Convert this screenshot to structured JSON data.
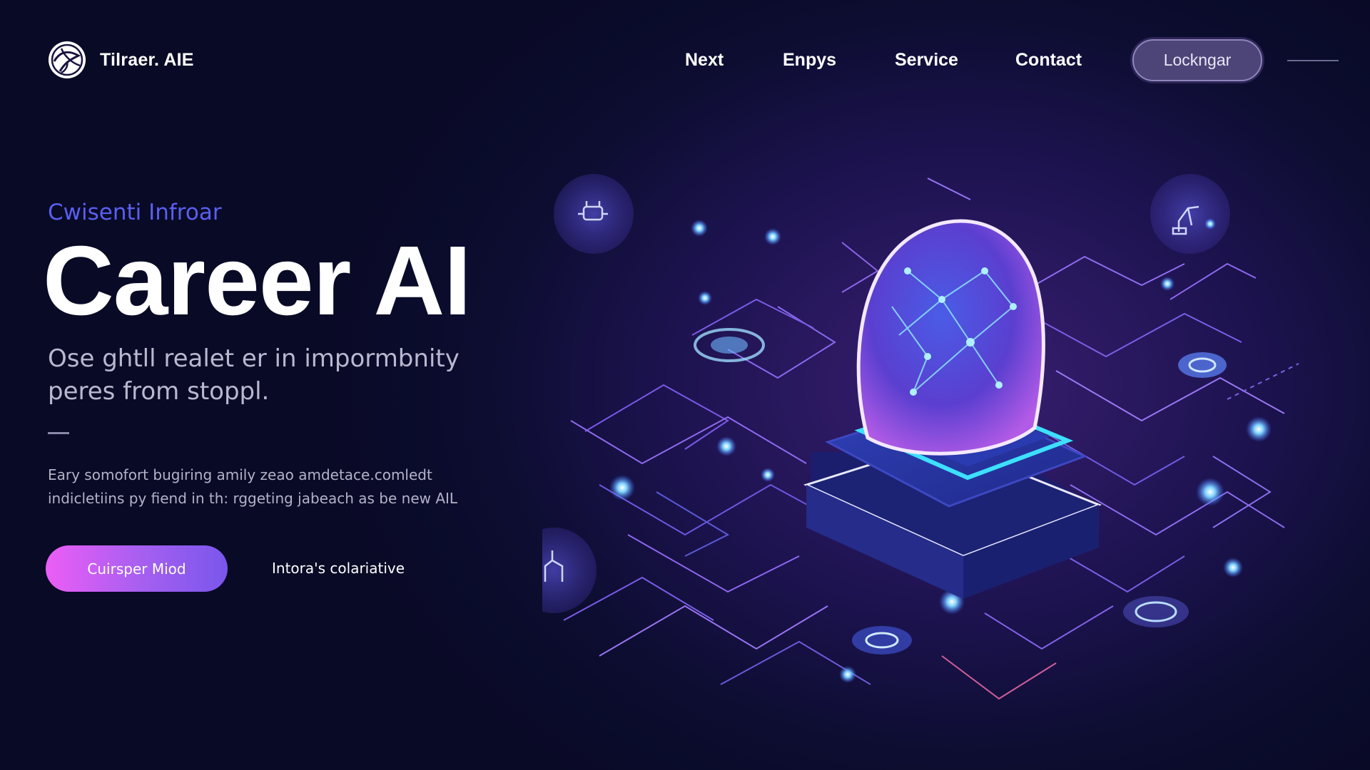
{
  "brand": {
    "name": "Tilraer. AIE",
    "logo_icon": "globe-leaf-logo-icon"
  },
  "nav": {
    "items": [
      "Next",
      "Enpys",
      "Service",
      "Contact"
    ]
  },
  "header": {
    "login_label": "Lockngar",
    "menu_icon": "menu-line-icon"
  },
  "hero": {
    "eyebrow": "Cwisenti Infroar",
    "title": "Career AI",
    "subtitle": "Ose ghtll realet er in impormbnity peres from stoppl.",
    "description": "Eary somofort bugiring amily zeao amdetace.comledt indicletiins py fiend in th: rggeting jabeach as be new AIL",
    "primary_cta": "Cuirsper Miod",
    "secondary_cta": "Intora's colariative"
  },
  "colors": {
    "accent": "#5a5ff0",
    "cta_start": "#ec5ef6",
    "cta_end": "#7a56ec",
    "background": "#0c0d30"
  },
  "illustration": {
    "icons": [
      "ai-brain-chip-icon",
      "tools-icon",
      "robot-arm-icon",
      "pipeline-icon"
    ]
  }
}
